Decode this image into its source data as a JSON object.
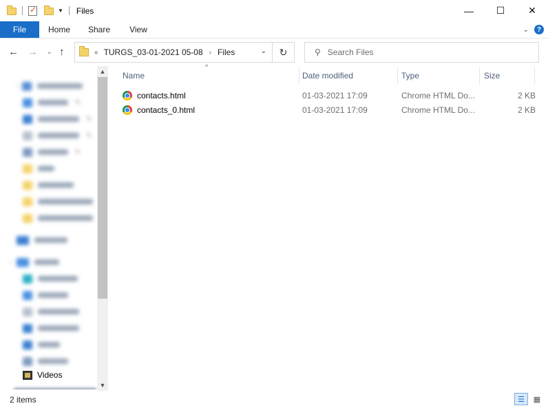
{
  "window": {
    "title": "Files",
    "controls": {
      "minimize": "—",
      "maximize": "☐",
      "close": "✕"
    }
  },
  "ribbon": {
    "tabs": [
      "File",
      "Home",
      "Share",
      "View"
    ],
    "expand_glyph": "⌄",
    "help_glyph": "?"
  },
  "nav": {
    "back": "←",
    "forward": "→",
    "recent": "⌄",
    "up": "↑",
    "overflow": "«",
    "breadcrumb": [
      "TURGS_03-01-2021 05-08",
      "Files"
    ],
    "refresh": "↻",
    "search_placeholder": "Search Files"
  },
  "sidebar": {
    "visible_item": "Videos"
  },
  "filelist": {
    "columns": [
      "Name",
      "Date modified",
      "Type",
      "Size"
    ],
    "files": [
      {
        "name": "contacts.html",
        "date": "01-03-2021 17:09",
        "type": "Chrome HTML Do...",
        "size": "2 KB"
      },
      {
        "name": "contacts_0.html",
        "date": "01-03-2021 17:09",
        "type": "Chrome HTML Do...",
        "size": "2 KB"
      }
    ]
  },
  "status": {
    "item_count": "2 items"
  },
  "colors": {
    "accent": "#1a6ec7",
    "header_text": "#4c607a",
    "folder": "#f4d36b"
  }
}
